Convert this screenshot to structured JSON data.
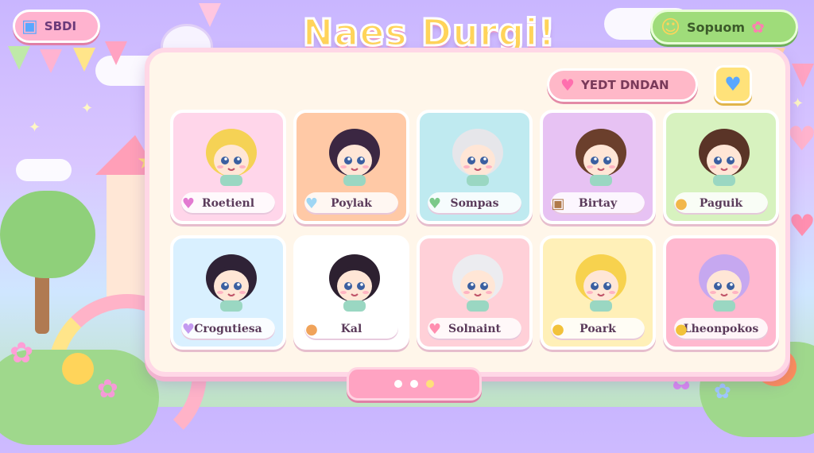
{
  "top_left_button": {
    "label": "SBDI",
    "icon": "gift-box-icon"
  },
  "title": "Naes Durgi!",
  "top_right_button": {
    "label": "Sopuom",
    "icon": "smiley-star-icon"
  },
  "board_header": {
    "action_label": "YEDT DNDAN",
    "action_icon": "heart-icon",
    "side_icon": "blue-heart-icon"
  },
  "characters": [
    {
      "name": "Roetienl",
      "hair": "#f5d255",
      "bg": "#ffd6ea",
      "badge": "♥",
      "badge_color": "#e27ad1"
    },
    {
      "name": "Poylak",
      "hair": "#3b2742",
      "bg": "#ffc9a6",
      "badge": "♥",
      "badge_color": "#9fd6f4"
    },
    {
      "name": "Sompas",
      "hair": "#e6e6ea",
      "bg": "#bfeaf0",
      "badge": "♥",
      "badge_color": "#7cc98a"
    },
    {
      "name": "Birtay",
      "hair": "#6b3f2c",
      "bg": "#e7c2f3",
      "badge": "▣",
      "badge_color": "#b07a4a"
    },
    {
      "name": "Paguik",
      "hair": "#5a3427",
      "bg": "#d7f2bf",
      "badge": "●",
      "badge_color": "#f2b74a"
    },
    {
      "name": "Crogutiesa",
      "hair": "#2f2236",
      "bg": "#d9f0ff",
      "badge": "♥",
      "badge_color": "#c39af0"
    },
    {
      "name": "Kal",
      "hair": "#2d2030",
      "bg": "#ffffff",
      "badge": "●",
      "badge_color": "#f0a35a"
    },
    {
      "name": "Solnaint",
      "hair": "#ececf0",
      "bg": "#ffd0d8",
      "badge": "♥",
      "badge_color": "#ff8fb0"
    },
    {
      "name": "Poark",
      "hair": "#f7d24e",
      "bg": "#fff0b8",
      "badge": "●",
      "badge_color": "#f2c23a"
    },
    {
      "name": "Lheonpokos",
      "hair": "#c6a8f0",
      "bg": "#ffb8cf",
      "badge": "●",
      "badge_color": "#f2c23a"
    }
  ],
  "pagination": {
    "count": 3
  }
}
